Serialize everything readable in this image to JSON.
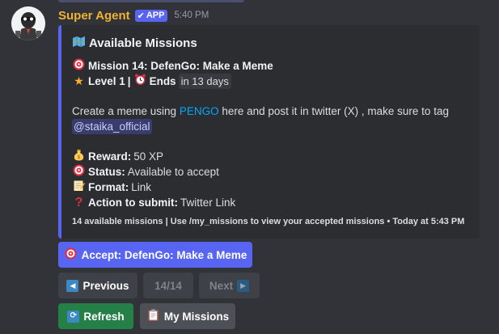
{
  "message": {
    "username": "Super Agent",
    "badge": "APP",
    "timestamp": "5:40 PM"
  },
  "embed": {
    "title_icon": "map-icon",
    "title": "Available Missions",
    "mission_name": "Mission 14: DefenGo: Make a Meme",
    "level": "Level 1",
    "separator": "|",
    "ends_label": "Ends",
    "ends_value": "in 13 days",
    "description_before_link": "Create a meme using ",
    "description_link": "PENGO",
    "description_after_link": " here and post it in twitter (X) , make sure to tag",
    "description_mention": "@staika_official",
    "reward_label": "Reward:",
    "reward_value": "50 XP",
    "status_label": "Status:",
    "status_value": "Available to accept",
    "format_label": "Format:",
    "format_value": "Link",
    "action_label": "Action to submit:",
    "action_value": "Twitter Link",
    "footer": "14 available missions | Use /my_missions to view your accepted missions • Today at 5:43 PM"
  },
  "buttons": {
    "accept": "Accept: DefenGo: Make a Meme",
    "previous": "Previous",
    "page": "14/14",
    "next": "Next",
    "refresh": "Refresh",
    "my_missions": "My Missions"
  },
  "colors": {
    "accent": "#5865f2",
    "username": "#f0b232",
    "success": "#248046",
    "link": "#00a8fc"
  }
}
